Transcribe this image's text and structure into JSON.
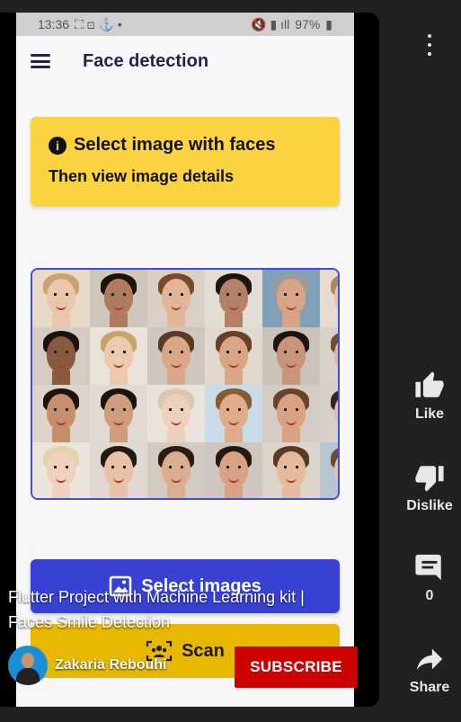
{
  "status_bar": {
    "time": "13:36",
    "battery": "97%"
  },
  "app": {
    "title": "Face detection",
    "info_card": {
      "line1": "Select image with faces",
      "line2": "Then view image details"
    },
    "select_button": "Select images",
    "scan_button": "Scan"
  },
  "video_overlay": {
    "title_line1": "Flutter Project with Machine Learning kit |",
    "title_line2": "Faces Smile Detection",
    "channel_name": "Zakaria Rebouhi",
    "subscribe_label": "SUBSCRIBE"
  },
  "actions": {
    "like_label": "Like",
    "dislike_label": "Dislike",
    "comments_count": "0",
    "share_label": "Share"
  },
  "colors": {
    "info_card": "#fbd240",
    "select_button": "#3941d4",
    "scan_button": "#e8b800",
    "subscribe": "#cc0000",
    "grid_border": "#3d4ee0"
  },
  "faces": [
    {
      "skin": "#e9c6ac",
      "hair": "#c9a36b",
      "bg": "#e8d9c9"
    },
    {
      "skin": "#b07b5c",
      "hair": "#1b1410",
      "bg": "#cfc6bb"
    },
    {
      "skin": "#e2b598",
      "hair": "#7a4a2a",
      "bg": "#d9cfc5"
    },
    {
      "skin": "#b68064",
      "hair": "#1c1512",
      "bg": "#e4ddd3"
    },
    {
      "skin": "#d7a584",
      "hair": "#9c9c9c",
      "bg": "#7fa0b8"
    },
    {
      "skin": "#e7c3a8",
      "hair": "#b08a5a",
      "bg": "#e6dbd0"
    },
    {
      "skin": "#8a5a3e",
      "hair": "#1a1310",
      "bg": "#d4cbc3"
    },
    {
      "skin": "#edc9ae",
      "hair": "#c8a468",
      "bg": "#ebe2d9"
    },
    {
      "skin": "#d9a788",
      "hair": "#5a3a24",
      "bg": "#cfc7bf"
    },
    {
      "skin": "#d8a685",
      "hair": "#6a4024",
      "bg": "#e2d8ce"
    },
    {
      "skin": "#c99578",
      "hair": "#1c1512",
      "bg": "#cbc2ba"
    },
    {
      "skin": "#e3b697",
      "hair": "#704c2e",
      "bg": "#dad1c8"
    },
    {
      "skin": "#c78e6e",
      "hair": "#1b1410",
      "bg": "#ddd4cb"
    },
    {
      "skin": "#cf9c7c",
      "hair": "#1a1310",
      "bg": "#e2dad2"
    },
    {
      "skin": "#ecd0bc",
      "hair": "#d8c8b0",
      "bg": "#e8e2da"
    },
    {
      "skin": "#e0ad8c",
      "hair": "#8a5a32",
      "bg": "#c9dbe6"
    },
    {
      "skin": "#d9a283",
      "hair": "#6b4428",
      "bg": "#d5cdc5"
    },
    {
      "skin": "#e7c0a4",
      "hair": "#3a2618",
      "bg": "#d8d0c8"
    },
    {
      "skin": "#f0d2bc",
      "hair": "#e4d2a8",
      "bg": "#ece5de"
    },
    {
      "skin": "#e8c2a6",
      "hair": "#231a14",
      "bg": "#e1d9d1"
    },
    {
      "skin": "#dcae90",
      "hair": "#2a1d14",
      "bg": "#d2c9c1"
    },
    {
      "skin": "#d7a383",
      "hair": "#231a14",
      "bg": "#cfc7bf"
    },
    {
      "skin": "#e5bb9e",
      "hair": "#5a3a24",
      "bg": "#dcd3ca"
    },
    {
      "skin": "#e7c3a8",
      "hair": "#6b4a30",
      "bg": "#b7c5d3"
    }
  ]
}
